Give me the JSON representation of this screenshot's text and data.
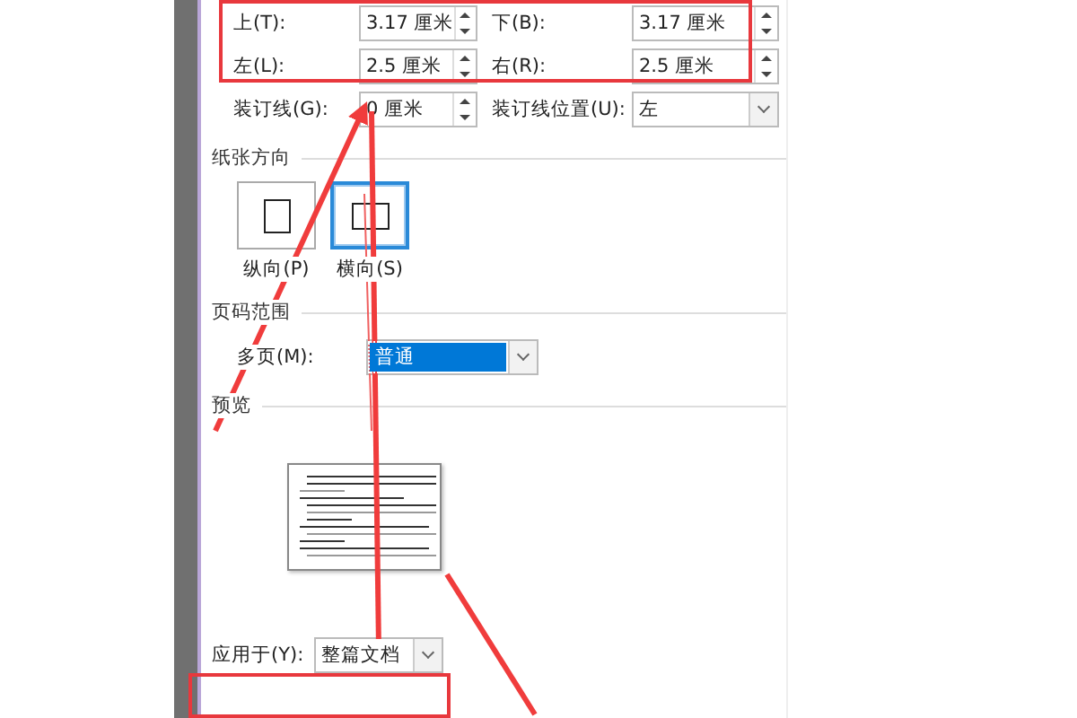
{
  "margins": [
    {
      "label": "上(T):",
      "value": "3.17 厘米"
    },
    {
      "label": "下(B):",
      "value": "3.17 厘米"
    },
    {
      "label": "左(L):",
      "value": "2.5 厘米"
    },
    {
      "label": "右(R):",
      "value": "2.5 厘米"
    }
  ],
  "gutter": {
    "label": "装订线(G):",
    "value": "0 厘米"
  },
  "gutter_position": {
    "label": "装订线位置(U):",
    "value": "左"
  },
  "orientation": {
    "title": "纸张方向",
    "options": [
      {
        "label": "纵向(P)",
        "kind": "portrait",
        "selected": false
      },
      {
        "label": "横向(S)",
        "kind": "landscape",
        "selected": true
      }
    ]
  },
  "pages": {
    "title": "页码范围",
    "label": "多页(M):",
    "value": "普通"
  },
  "preview": {
    "title": "预览"
  },
  "apply_to": {
    "label": "应用于(Y):",
    "value": "整篇文档"
  }
}
